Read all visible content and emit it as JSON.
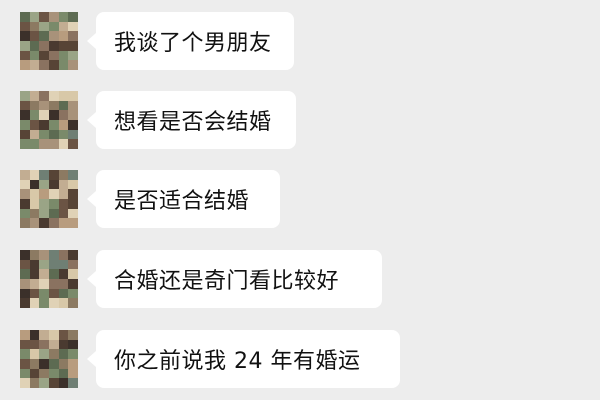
{
  "messages": [
    {
      "text": "我谈了个男朋友",
      "avatar_icon": "pixelated-avatar-icon"
    },
    {
      "text": "想看是否会结婚",
      "avatar_icon": "pixelated-avatar-icon"
    },
    {
      "text": "是否适合结婚",
      "avatar_icon": "pixelated-avatar-icon"
    },
    {
      "text": "合婚还是奇门看比较好",
      "avatar_icon": "pixelated-avatar-icon"
    },
    {
      "text": "你之前说我 24 年有婚运",
      "avatar_icon": "pixelated-avatar-icon"
    }
  ],
  "colors": {
    "background": "#ededed",
    "bubble": "#ffffff",
    "text": "#111111"
  }
}
